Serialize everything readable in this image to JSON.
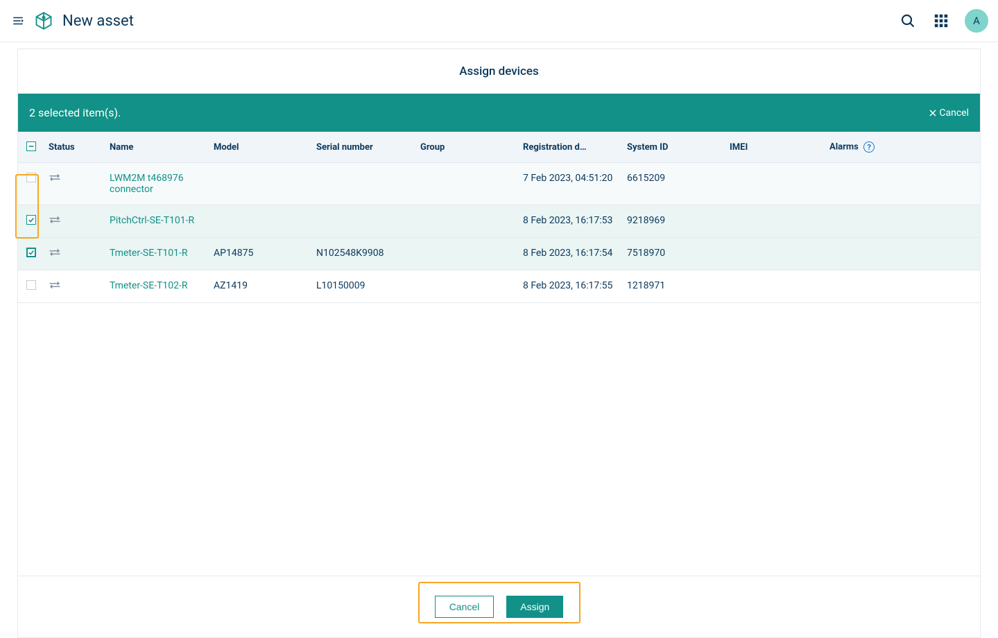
{
  "header": {
    "title": "New asset",
    "avatar_initial": "A"
  },
  "panel": {
    "title": "Assign devices"
  },
  "selection_bar": {
    "text": "2 selected item(s).",
    "cancel_label": "Cancel"
  },
  "table": {
    "headers": {
      "status": "Status",
      "name": "Name",
      "model": "Model",
      "serial": "Serial number",
      "group": "Group",
      "registration": "Registration d…",
      "system_id": "System ID",
      "imei": "IMEI",
      "alarms": "Alarms"
    },
    "rows": [
      {
        "checked": false,
        "name": "LWM2M t468976 connector",
        "model": "",
        "serial": "",
        "group": "",
        "registration": "7 Feb 2023, 04:51:20",
        "system_id": "6615209",
        "imei": "",
        "alarms": ""
      },
      {
        "checked": true,
        "name": "PitchCtrl-SE-T101-R",
        "model": "",
        "serial": "",
        "group": "",
        "registration": "8 Feb 2023, 16:17:53",
        "system_id": "9218969",
        "imei": "",
        "alarms": ""
      },
      {
        "checked": true,
        "strong": true,
        "name": "Tmeter-SE-T101-R",
        "model": "AP14875",
        "serial": "N102548K9908",
        "group": "",
        "registration": "8 Feb 2023, 16:17:54",
        "system_id": "7518970",
        "imei": "",
        "alarms": ""
      },
      {
        "checked": false,
        "name": "Tmeter-SE-T102-R",
        "model": "AZ1419",
        "serial": "L10150009",
        "group": "",
        "registration": "8 Feb 2023, 16:17:55",
        "system_id": "1218971",
        "imei": "",
        "alarms": ""
      }
    ]
  },
  "footer": {
    "cancel": "Cancel",
    "assign": "Assign"
  }
}
